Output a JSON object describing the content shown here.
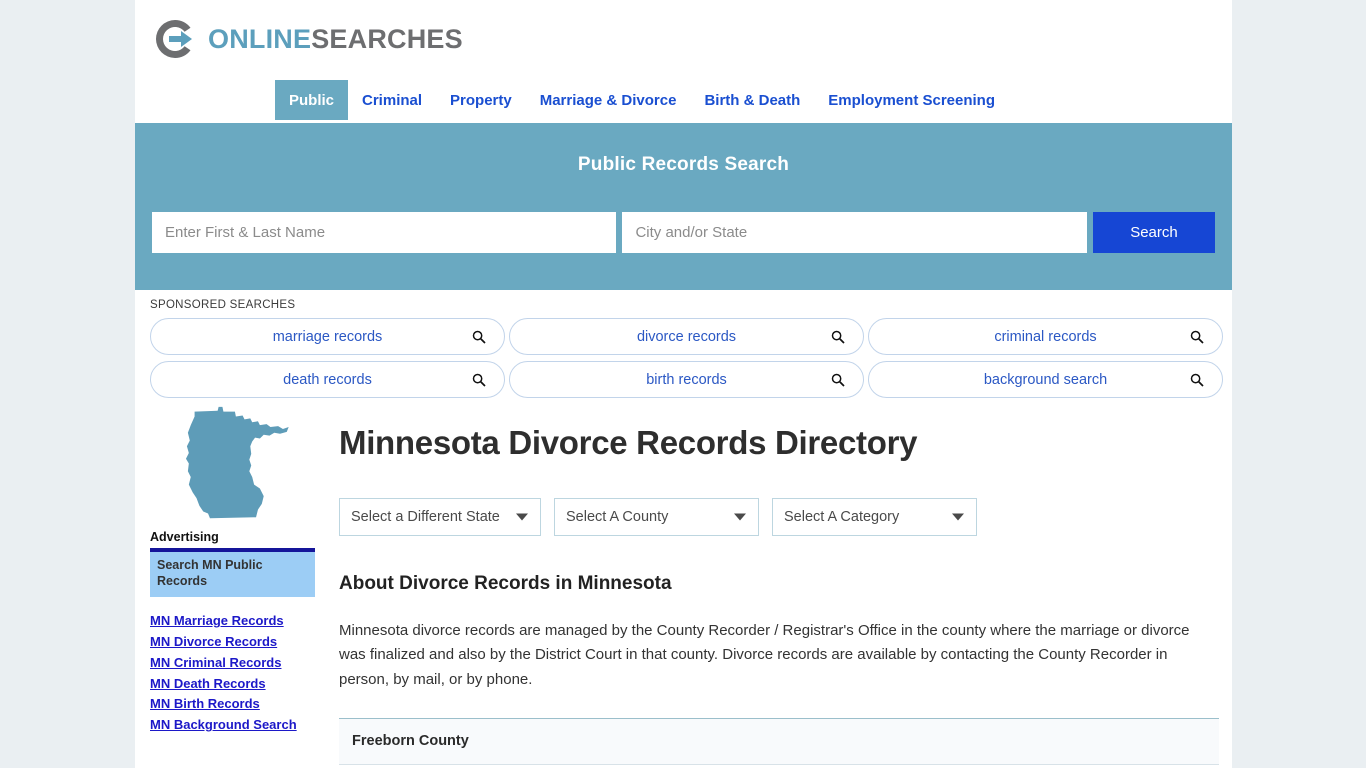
{
  "brand": {
    "logo_icon": "circle-arrow-logo-icon",
    "name_part1": "ONLINE",
    "name_part2": "SEARCHES"
  },
  "nav": {
    "items": [
      {
        "label": "Public",
        "active": true
      },
      {
        "label": "Criminal",
        "active": false
      },
      {
        "label": "Property",
        "active": false
      },
      {
        "label": "Marriage & Divorce",
        "active": false
      },
      {
        "label": "Birth & Death",
        "active": false
      },
      {
        "label": "Employment Screening",
        "active": false
      }
    ]
  },
  "banner": {
    "title": "Public Records Search",
    "name_placeholder": "Enter First & Last Name",
    "name_value": "",
    "location_placeholder": "City and/or State",
    "location_value": "",
    "search_button": "Search",
    "bg_color": "#6aa9c1",
    "button_color": "#1646d4"
  },
  "sponsored": {
    "label": "SPONSORED SEARCHES",
    "items": [
      {
        "label": "marriage records",
        "icon": "search-icon"
      },
      {
        "label": "divorce records",
        "icon": "search-icon"
      },
      {
        "label": "criminal records",
        "icon": "search-icon"
      },
      {
        "label": "death records",
        "icon": "search-icon"
      },
      {
        "label": "birth records",
        "icon": "search-icon"
      },
      {
        "label": "background search",
        "icon": "search-icon"
      }
    ]
  },
  "sidebar": {
    "map_icon": "minnesota-state-map-icon",
    "advertising_label": "Advertising",
    "ad_text": "Search MN Public Records",
    "links": [
      "MN Marriage Records",
      "MN Divorce Records",
      "MN Criminal Records",
      "MN Death Records",
      "MN Birth Records",
      "MN Background Search"
    ]
  },
  "main": {
    "page_title": "Minnesota Divorce Records Directory",
    "selects": [
      {
        "label": "Select a Different State",
        "icon": "chevron-down-icon"
      },
      {
        "label": "Select A County",
        "icon": "chevron-down-icon"
      },
      {
        "label": "Select A Category",
        "icon": "chevron-down-icon"
      }
    ],
    "section_title": "About Divorce Records in Minnesota",
    "about_text": "Minnesota divorce records are managed by the County Recorder / Registrar's Office in the county where the marriage or divorce was finalized and also by the District Court in that county. Divorce records are available by contacting the County Recorder in person, by mail, or by phone.",
    "counties": [
      "Freeborn County"
    ]
  }
}
